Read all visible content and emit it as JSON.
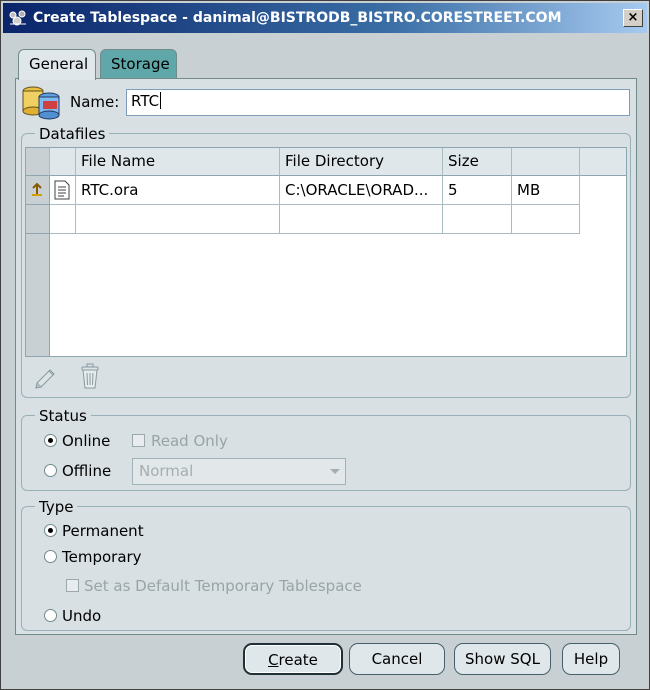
{
  "window": {
    "title": "Create Tablespace - danimal@BISTRODB_BISTRO.CORESTREET.COM",
    "close_glyph": "×"
  },
  "tabs": [
    {
      "label": "General",
      "selected": true
    },
    {
      "label": "Storage",
      "selected": false
    }
  ],
  "name": {
    "label": "Name:",
    "value": "RTC"
  },
  "datafiles": {
    "legend": "Datafiles",
    "columns": [
      "File Name",
      "File Directory",
      "Size",
      ""
    ],
    "rows": [
      {
        "file_name": "RTC.ora",
        "file_directory": "C:\\ORACLE\\ORAD...",
        "size": "5",
        "unit": "MB"
      }
    ],
    "tools": [
      "edit-pencil-icon",
      "trash-can-icon"
    ]
  },
  "status": {
    "legend": "Status",
    "online_label": "Online",
    "online_checked": true,
    "read_only_label": "Read Only",
    "offline_label": "Offline",
    "offline_mode": "Normal"
  },
  "type": {
    "legend": "Type",
    "permanent_label": "Permanent",
    "permanent_checked": true,
    "temporary_label": "Temporary",
    "default_temp_label": "Set as Default Temporary Tablespace",
    "undo_label": "Undo"
  },
  "buttons": {
    "create_mnemonic": "C",
    "create_rest": "reate",
    "cancel": "Cancel",
    "show_sql": "Show SQL",
    "help": "Help"
  },
  "colors": {
    "title_bar": "#0a246a",
    "storage_tab": "#5fa7a8",
    "panel": "#d8e0e3"
  }
}
